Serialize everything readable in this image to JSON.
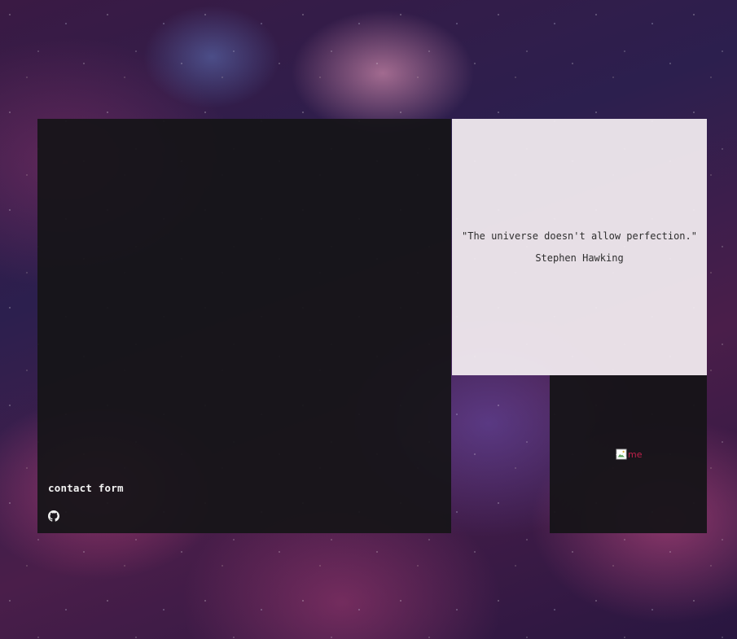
{
  "contact_panel": {
    "link_label": "contact form",
    "github_icon": "github-icon"
  },
  "quote_panel": {
    "quote": "\"The universe doesn't allow perfection.\"",
    "author": "Stephen Hawking"
  },
  "photo_panel": {
    "image_alt": "me",
    "image_state": "broken-image-icon"
  },
  "colors": {
    "dark_panel": "#161418",
    "light_panel": "#f4eef2",
    "alt_text": "#c0204a"
  }
}
